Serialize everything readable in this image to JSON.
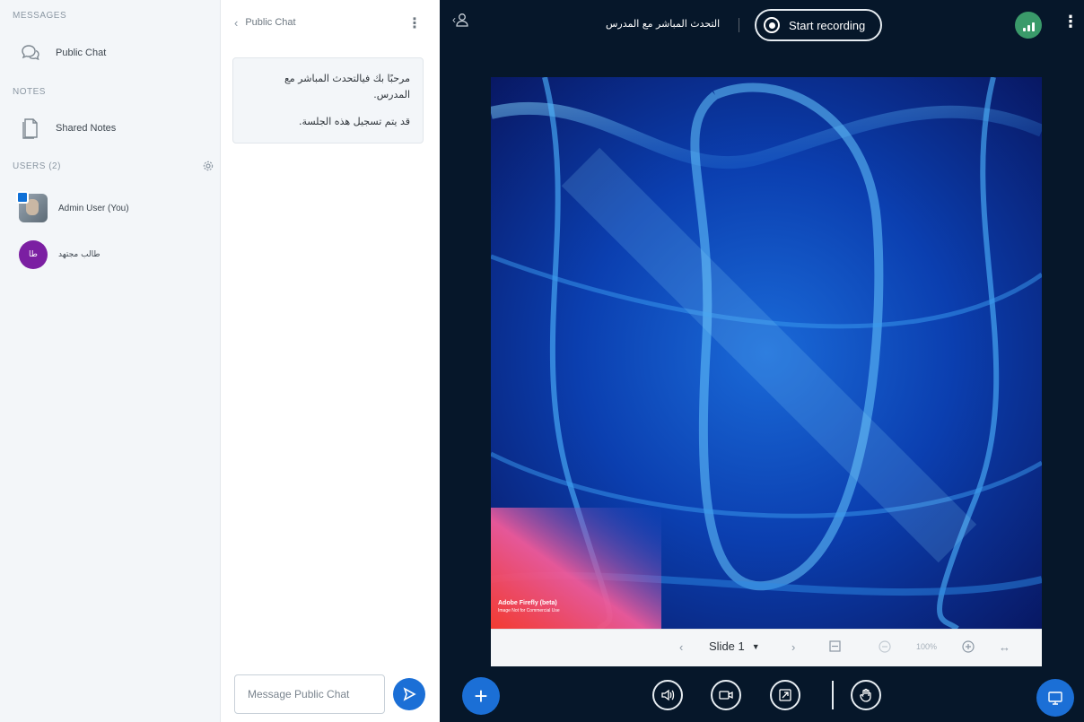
{
  "sidebar": {
    "messages_title": "MESSAGES",
    "public_chat_label": "Public Chat",
    "notes_title": "NOTES",
    "shared_notes_label": "Shared Notes",
    "users_title": "USERS (2)",
    "users": [
      {
        "name": "Admin User (You)",
        "avatar": "photo",
        "moderator": true
      },
      {
        "name": "طالب مجتهد",
        "avatar_initials": "طا",
        "avatar_color": "#7b1fa2"
      }
    ]
  },
  "chat": {
    "title": "Public Chat",
    "welcome_line1": "مرحبًا بك فيالتحدث المباشر مع المدرس.",
    "welcome_line2": "قد يتم تسجيل هذه الجلسة.",
    "input_placeholder": "Message Public Chat"
  },
  "main": {
    "meeting_title": "التحدث المباشر مع المدرس",
    "record_label": "Start recording",
    "connection_color": "#3a9a6a",
    "slide_label": "Slide 1",
    "zoom": "100%",
    "watermark_title": "Adobe Firefly (beta)",
    "watermark_sub": "Image Not for Commercial Use"
  },
  "colors": {
    "accent": "#1b6fd6",
    "main_bg": "#06172a",
    "sidebar_bg": "#f3f6f9"
  }
}
